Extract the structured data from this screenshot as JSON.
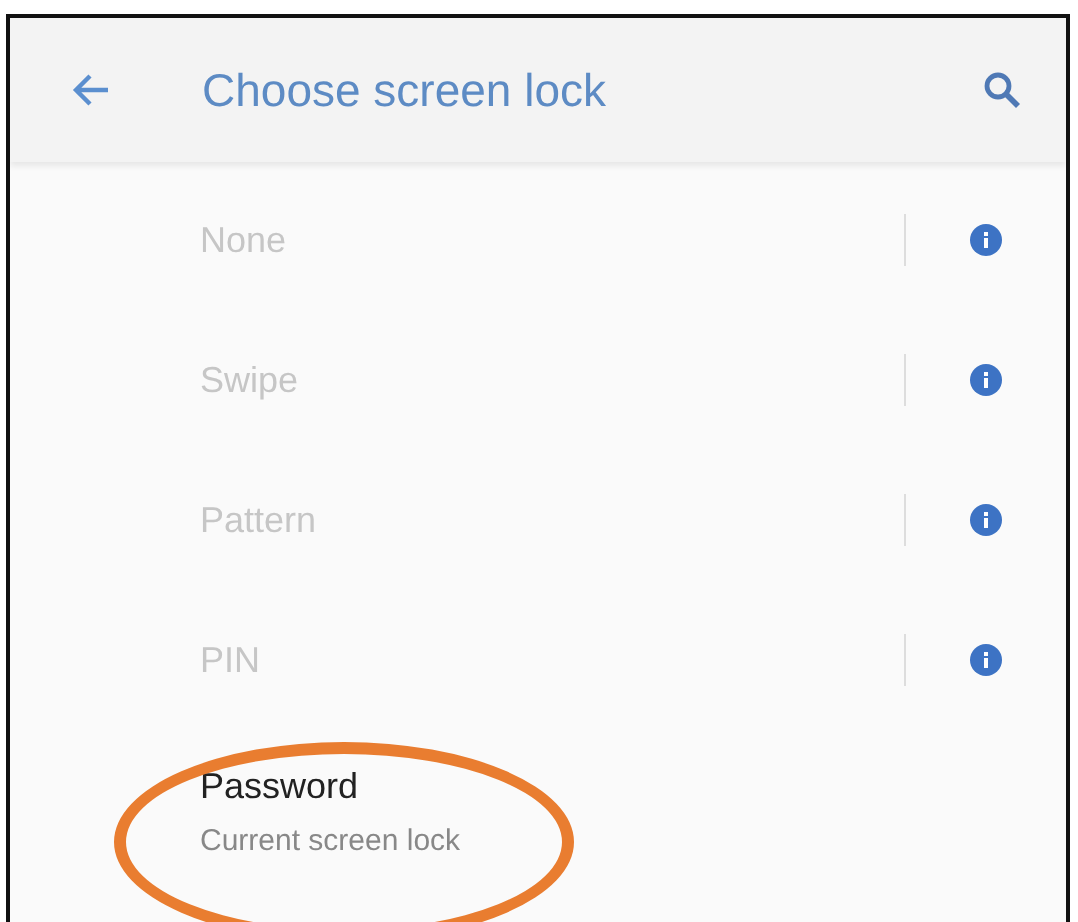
{
  "header": {
    "title": "Choose screen lock"
  },
  "options": [
    {
      "label": "None",
      "disabled": true,
      "info": true,
      "circled": false
    },
    {
      "label": "Swipe",
      "disabled": true,
      "info": true,
      "circled": false
    },
    {
      "label": "Pattern",
      "disabled": true,
      "info": true,
      "circled": false
    },
    {
      "label": "PIN",
      "disabled": true,
      "info": true,
      "circled": false
    },
    {
      "label": "Password",
      "summary": "Current screen lock",
      "disabled": false,
      "info": false,
      "circled": true
    }
  ]
}
